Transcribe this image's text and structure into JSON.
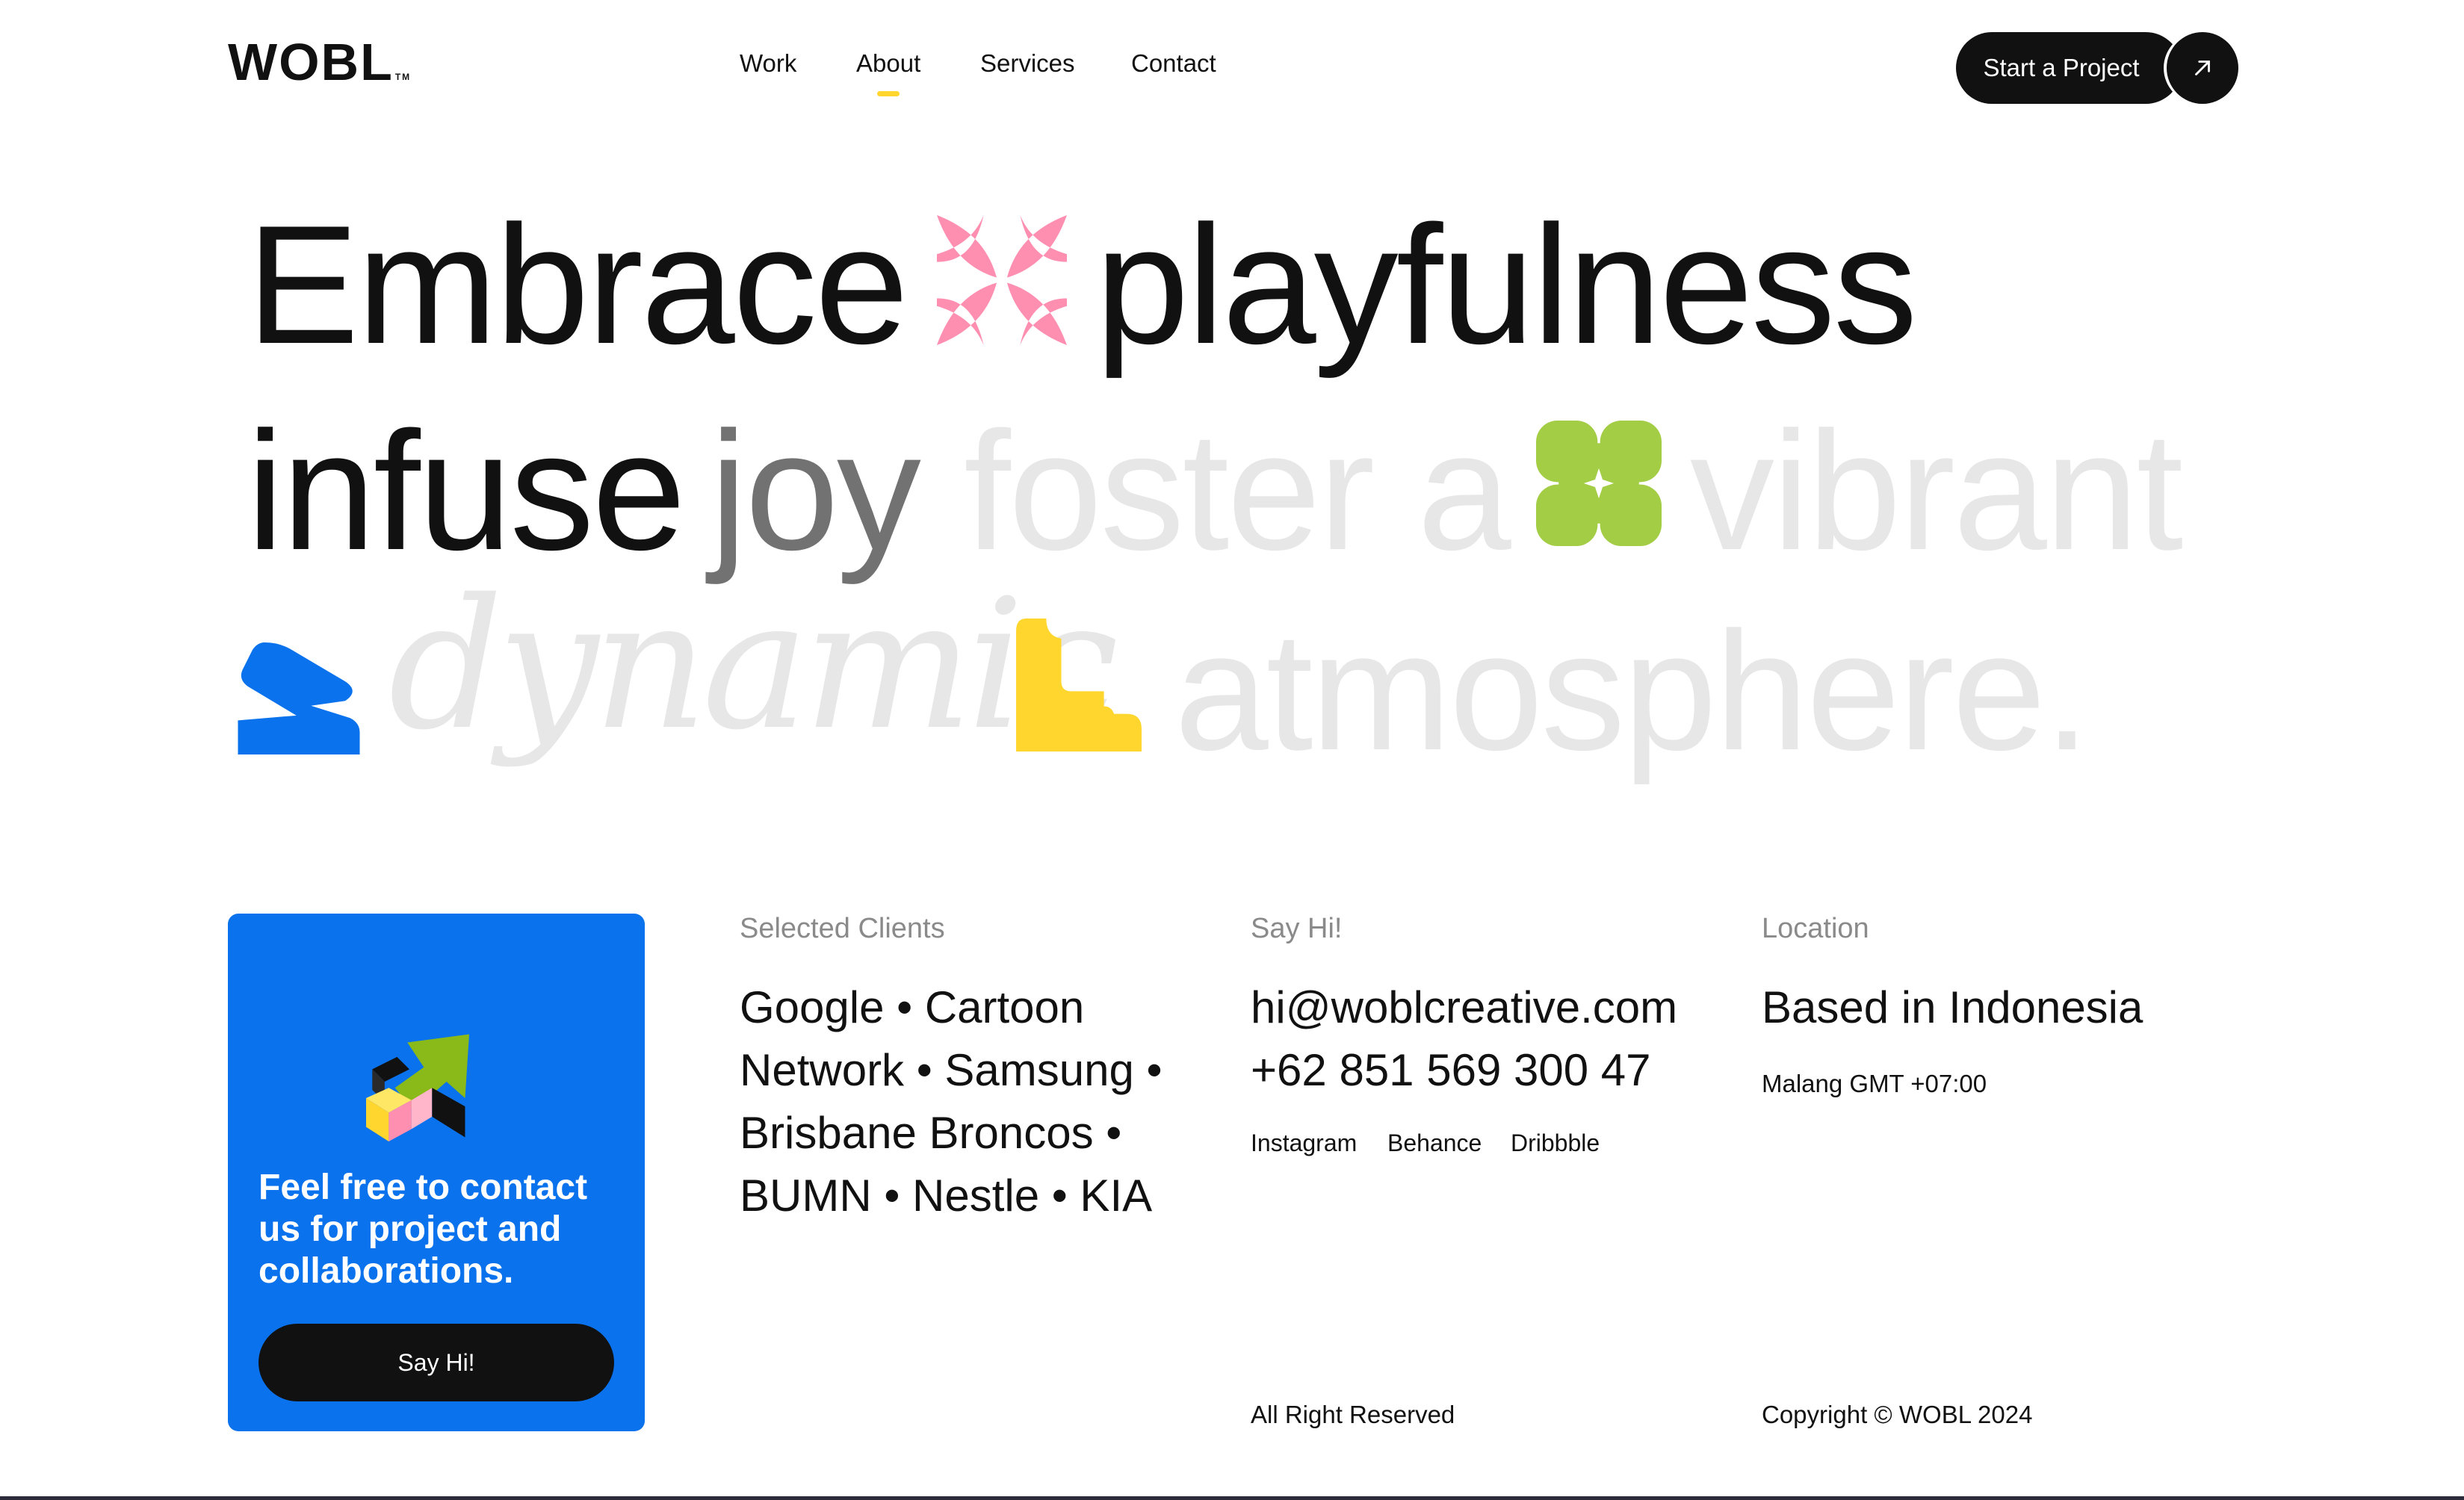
{
  "header": {
    "logo": "WOBL",
    "logo_tm": "TM",
    "nav": [
      {
        "label": "Work",
        "active": false
      },
      {
        "label": "About",
        "active": true
      },
      {
        "label": "Services",
        "active": false
      },
      {
        "label": "Contact",
        "active": false
      }
    ],
    "cta_label": "Start a Project",
    "cta_icon": "arrow-up-right-icon"
  },
  "hero": {
    "line1": {
      "w1": "Embrace",
      "w2": "playfulness"
    },
    "line2": {
      "w1": "infuse",
      "w2": "joy",
      "w3": "foster a",
      "w4": "vibrant"
    },
    "line3": {
      "w1": "dynamic",
      "w2": "atmosphere."
    },
    "shape_colors": {
      "pink": "#FF8FB1",
      "green": "#A3CD45",
      "blue": "#0A72EC",
      "yellow": "#FFD62E"
    }
  },
  "card": {
    "text": "Feel free to contact us for project and collaborations.",
    "button": "Say Hi!",
    "color": "#0A72EC"
  },
  "clients": {
    "label": "Selected Clients",
    "list": "Google • Cartoon Network • Samsung • Brisbane Broncos • BUMN • Nestle • KIA"
  },
  "contact": {
    "label": "Say Hi!",
    "email": "hi@woblcreative.com",
    "phone": "+62 851 569 300 47",
    "socials": [
      "Instagram",
      "Behance",
      "Dribbble"
    ]
  },
  "location": {
    "label": "Location",
    "headline": "Based in Indonesia",
    "detail": "Malang GMT +07:00"
  },
  "footer": {
    "rights": "All Right Reserved",
    "copyright": "Copyright © WOBL 2024"
  }
}
